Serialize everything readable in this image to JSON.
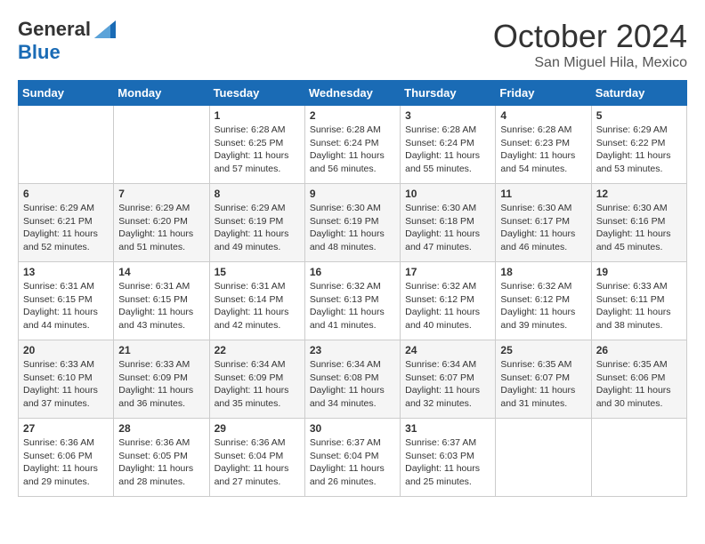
{
  "header": {
    "logo_general": "General",
    "logo_blue": "Blue",
    "month": "October 2024",
    "location": "San Miguel Hila, Mexico"
  },
  "days_of_week": [
    "Sunday",
    "Monday",
    "Tuesday",
    "Wednesday",
    "Thursday",
    "Friday",
    "Saturday"
  ],
  "weeks": [
    [
      {
        "day": "",
        "sunrise": "",
        "sunset": "",
        "daylight": ""
      },
      {
        "day": "",
        "sunrise": "",
        "sunset": "",
        "daylight": ""
      },
      {
        "day": "1",
        "sunrise": "Sunrise: 6:28 AM",
        "sunset": "Sunset: 6:25 PM",
        "daylight": "Daylight: 11 hours and 57 minutes."
      },
      {
        "day": "2",
        "sunrise": "Sunrise: 6:28 AM",
        "sunset": "Sunset: 6:24 PM",
        "daylight": "Daylight: 11 hours and 56 minutes."
      },
      {
        "day": "3",
        "sunrise": "Sunrise: 6:28 AM",
        "sunset": "Sunset: 6:24 PM",
        "daylight": "Daylight: 11 hours and 55 minutes."
      },
      {
        "day": "4",
        "sunrise": "Sunrise: 6:28 AM",
        "sunset": "Sunset: 6:23 PM",
        "daylight": "Daylight: 11 hours and 54 minutes."
      },
      {
        "day": "5",
        "sunrise": "Sunrise: 6:29 AM",
        "sunset": "Sunset: 6:22 PM",
        "daylight": "Daylight: 11 hours and 53 minutes."
      }
    ],
    [
      {
        "day": "6",
        "sunrise": "Sunrise: 6:29 AM",
        "sunset": "Sunset: 6:21 PM",
        "daylight": "Daylight: 11 hours and 52 minutes."
      },
      {
        "day": "7",
        "sunrise": "Sunrise: 6:29 AM",
        "sunset": "Sunset: 6:20 PM",
        "daylight": "Daylight: 11 hours and 51 minutes."
      },
      {
        "day": "8",
        "sunrise": "Sunrise: 6:29 AM",
        "sunset": "Sunset: 6:19 PM",
        "daylight": "Daylight: 11 hours and 49 minutes."
      },
      {
        "day": "9",
        "sunrise": "Sunrise: 6:30 AM",
        "sunset": "Sunset: 6:19 PM",
        "daylight": "Daylight: 11 hours and 48 minutes."
      },
      {
        "day": "10",
        "sunrise": "Sunrise: 6:30 AM",
        "sunset": "Sunset: 6:18 PM",
        "daylight": "Daylight: 11 hours and 47 minutes."
      },
      {
        "day": "11",
        "sunrise": "Sunrise: 6:30 AM",
        "sunset": "Sunset: 6:17 PM",
        "daylight": "Daylight: 11 hours and 46 minutes."
      },
      {
        "day": "12",
        "sunrise": "Sunrise: 6:30 AM",
        "sunset": "Sunset: 6:16 PM",
        "daylight": "Daylight: 11 hours and 45 minutes."
      }
    ],
    [
      {
        "day": "13",
        "sunrise": "Sunrise: 6:31 AM",
        "sunset": "Sunset: 6:15 PM",
        "daylight": "Daylight: 11 hours and 44 minutes."
      },
      {
        "day": "14",
        "sunrise": "Sunrise: 6:31 AM",
        "sunset": "Sunset: 6:15 PM",
        "daylight": "Daylight: 11 hours and 43 minutes."
      },
      {
        "day": "15",
        "sunrise": "Sunrise: 6:31 AM",
        "sunset": "Sunset: 6:14 PM",
        "daylight": "Daylight: 11 hours and 42 minutes."
      },
      {
        "day": "16",
        "sunrise": "Sunrise: 6:32 AM",
        "sunset": "Sunset: 6:13 PM",
        "daylight": "Daylight: 11 hours and 41 minutes."
      },
      {
        "day": "17",
        "sunrise": "Sunrise: 6:32 AM",
        "sunset": "Sunset: 6:12 PM",
        "daylight": "Daylight: 11 hours and 40 minutes."
      },
      {
        "day": "18",
        "sunrise": "Sunrise: 6:32 AM",
        "sunset": "Sunset: 6:12 PM",
        "daylight": "Daylight: 11 hours and 39 minutes."
      },
      {
        "day": "19",
        "sunrise": "Sunrise: 6:33 AM",
        "sunset": "Sunset: 6:11 PM",
        "daylight": "Daylight: 11 hours and 38 minutes."
      }
    ],
    [
      {
        "day": "20",
        "sunrise": "Sunrise: 6:33 AM",
        "sunset": "Sunset: 6:10 PM",
        "daylight": "Daylight: 11 hours and 37 minutes."
      },
      {
        "day": "21",
        "sunrise": "Sunrise: 6:33 AM",
        "sunset": "Sunset: 6:09 PM",
        "daylight": "Daylight: 11 hours and 36 minutes."
      },
      {
        "day": "22",
        "sunrise": "Sunrise: 6:34 AM",
        "sunset": "Sunset: 6:09 PM",
        "daylight": "Daylight: 11 hours and 35 minutes."
      },
      {
        "day": "23",
        "sunrise": "Sunrise: 6:34 AM",
        "sunset": "Sunset: 6:08 PM",
        "daylight": "Daylight: 11 hours and 34 minutes."
      },
      {
        "day": "24",
        "sunrise": "Sunrise: 6:34 AM",
        "sunset": "Sunset: 6:07 PM",
        "daylight": "Daylight: 11 hours and 32 minutes."
      },
      {
        "day": "25",
        "sunrise": "Sunrise: 6:35 AM",
        "sunset": "Sunset: 6:07 PM",
        "daylight": "Daylight: 11 hours and 31 minutes."
      },
      {
        "day": "26",
        "sunrise": "Sunrise: 6:35 AM",
        "sunset": "Sunset: 6:06 PM",
        "daylight": "Daylight: 11 hours and 30 minutes."
      }
    ],
    [
      {
        "day": "27",
        "sunrise": "Sunrise: 6:36 AM",
        "sunset": "Sunset: 6:06 PM",
        "daylight": "Daylight: 11 hours and 29 minutes."
      },
      {
        "day": "28",
        "sunrise": "Sunrise: 6:36 AM",
        "sunset": "Sunset: 6:05 PM",
        "daylight": "Daylight: 11 hours and 28 minutes."
      },
      {
        "day": "29",
        "sunrise": "Sunrise: 6:36 AM",
        "sunset": "Sunset: 6:04 PM",
        "daylight": "Daylight: 11 hours and 27 minutes."
      },
      {
        "day": "30",
        "sunrise": "Sunrise: 6:37 AM",
        "sunset": "Sunset: 6:04 PM",
        "daylight": "Daylight: 11 hours and 26 minutes."
      },
      {
        "day": "31",
        "sunrise": "Sunrise: 6:37 AM",
        "sunset": "Sunset: 6:03 PM",
        "daylight": "Daylight: 11 hours and 25 minutes."
      },
      {
        "day": "",
        "sunrise": "",
        "sunset": "",
        "daylight": ""
      },
      {
        "day": "",
        "sunrise": "",
        "sunset": "",
        "daylight": ""
      }
    ]
  ]
}
